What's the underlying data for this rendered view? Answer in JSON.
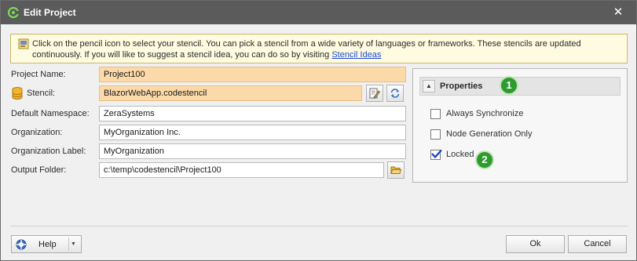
{
  "window": {
    "title": "Edit Project",
    "close_glyph": "✕"
  },
  "info": {
    "text": "Click on the pencil icon to select your stencil. You can pick a stencil from a wide variety of languages or frameworks. These stencils are updated continuously. If you will like to suggest a stencil idea, you can do so by visiting ",
    "link_text": "Stencil Ideas"
  },
  "form": {
    "project_name": {
      "label": "Project Name:",
      "value": "Project100"
    },
    "stencil": {
      "label": "Stencil:",
      "value": "BlazorWebApp.codestencil"
    },
    "default_namespace": {
      "label": "Default Namespace:",
      "value": "ZeraSystems"
    },
    "organization": {
      "label": "Organization:",
      "value": "MyOrganization Inc."
    },
    "organization_label": {
      "label": "Organization Label:",
      "value": "MyOrganization"
    },
    "output_folder": {
      "label": "Output Folder:",
      "value": "c:\\temp\\codestencil\\Project100"
    }
  },
  "properties": {
    "title": "Properties",
    "collapse_glyph": "▲",
    "items": [
      {
        "label": "Always Synchronize",
        "checked": false
      },
      {
        "label": "Node Generation Only",
        "checked": false
      },
      {
        "label": "Locked",
        "checked": true
      }
    ]
  },
  "badges": [
    "1",
    "2"
  ],
  "footer": {
    "help_label": "Help",
    "help_arrow": "▼",
    "ok_label": "Ok",
    "cancel_label": "Cancel"
  },
  "colors": {
    "title_bar": "#5b5b5b",
    "highlight_field": "#fcd9a8",
    "info_background": "#fffbe0",
    "badge_green": "#2f9a2f",
    "link": "#1a4bd6"
  },
  "icons": [
    "app-logo-icon",
    "close-icon",
    "info-note-icon",
    "database-icon",
    "pencil-edit-icon",
    "refresh-icon",
    "folder-open-icon",
    "help-icon",
    "collapse-arrow-icon",
    "checkmark-icon"
  ]
}
